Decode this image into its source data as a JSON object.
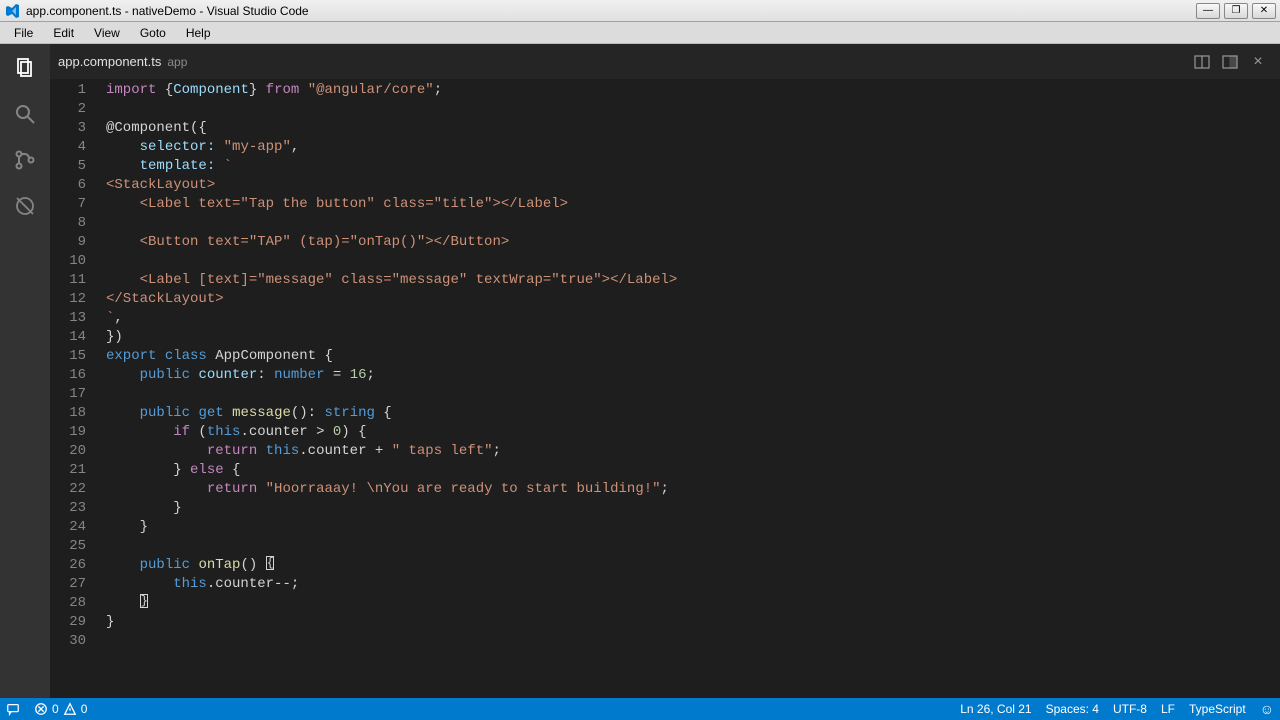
{
  "window": {
    "title": "app.component.ts - nativeDemo - Visual Studio Code"
  },
  "menubar": {
    "items": [
      "File",
      "Edit",
      "View",
      "Goto",
      "Help"
    ]
  },
  "tab": {
    "name": "app.component.ts",
    "path": "app"
  },
  "activity": {
    "items": [
      "files-icon",
      "search-icon",
      "git-icon",
      "debug-icon"
    ]
  },
  "statusbar": {
    "errors": "0",
    "warnings": "0",
    "ln_col": "Ln 26, Col 21",
    "spaces": "Spaces: 4",
    "encoding": "UTF-8",
    "eol": "LF",
    "language": "TypeScript"
  },
  "code": {
    "lines": 30,
    "content": [
      {
        "n": 1,
        "tokens": [
          {
            "t": "import",
            "c": "kw-import"
          },
          {
            "t": " ",
            "c": ""
          },
          {
            "t": "{",
            "c": ""
          },
          {
            "t": "Component",
            "c": "var"
          },
          {
            "t": "}",
            "c": ""
          },
          {
            "t": " ",
            "c": ""
          },
          {
            "t": "from",
            "c": "kw-from"
          },
          {
            "t": " ",
            "c": ""
          },
          {
            "t": "\"@angular/core\"",
            "c": "str"
          },
          {
            "t": ";",
            "c": ""
          }
        ]
      },
      {
        "n": 2,
        "tokens": []
      },
      {
        "n": 3,
        "tokens": [
          {
            "t": "@Component({",
            "c": ""
          }
        ]
      },
      {
        "n": 4,
        "tokens": [
          {
            "t": "    ",
            "c": ""
          },
          {
            "t": "selector:",
            "c": "sel"
          },
          {
            "t": " ",
            "c": ""
          },
          {
            "t": "\"my-app\"",
            "c": "str"
          },
          {
            "t": ",",
            "c": ""
          }
        ]
      },
      {
        "n": 5,
        "tokens": [
          {
            "t": "    ",
            "c": ""
          },
          {
            "t": "template:",
            "c": "sel"
          },
          {
            "t": " ",
            "c": ""
          },
          {
            "t": "`",
            "c": "str"
          }
        ]
      },
      {
        "n": 6,
        "tokens": [
          {
            "t": "<StackLayout>",
            "c": "str"
          }
        ]
      },
      {
        "n": 7,
        "tokens": [
          {
            "t": "    <Label text=\"Tap the button\" class=\"title\"></Label>",
            "c": "str"
          }
        ]
      },
      {
        "n": 8,
        "tokens": []
      },
      {
        "n": 9,
        "tokens": [
          {
            "t": "    <Button text=\"TAP\" (tap)=\"onTap()\"></Button>",
            "c": "str"
          }
        ]
      },
      {
        "n": 10,
        "tokens": []
      },
      {
        "n": 11,
        "tokens": [
          {
            "t": "    <Label [text]=\"message\" class=\"message\" textWrap=\"true\"></Label>",
            "c": "str"
          }
        ]
      },
      {
        "n": 12,
        "tokens": [
          {
            "t": "</StackLayout>",
            "c": "str"
          }
        ]
      },
      {
        "n": 13,
        "tokens": [
          {
            "t": "`",
            "c": "str"
          },
          {
            "t": ",",
            "c": ""
          }
        ]
      },
      {
        "n": 14,
        "tokens": [
          {
            "t": "})",
            "c": ""
          }
        ]
      },
      {
        "n": 15,
        "tokens": [
          {
            "t": "export",
            "c": "kw-export"
          },
          {
            "t": " ",
            "c": ""
          },
          {
            "t": "class",
            "c": "kw-class"
          },
          {
            "t": " ",
            "c": ""
          },
          {
            "t": "AppComponent",
            "c": "cls"
          },
          {
            "t": " {",
            "c": ""
          }
        ]
      },
      {
        "n": 16,
        "tokens": [
          {
            "t": "    ",
            "c": ""
          },
          {
            "t": "public",
            "c": "kw-mod"
          },
          {
            "t": " ",
            "c": ""
          },
          {
            "t": "counter",
            "c": "var"
          },
          {
            "t": ": ",
            "c": ""
          },
          {
            "t": "number",
            "c": "kw-type"
          },
          {
            "t": " = ",
            "c": ""
          },
          {
            "t": "16",
            "c": "kw-num"
          },
          {
            "t": ";",
            "c": ""
          }
        ]
      },
      {
        "n": 17,
        "tokens": []
      },
      {
        "n": 18,
        "tokens": [
          {
            "t": "    ",
            "c": ""
          },
          {
            "t": "public",
            "c": "kw-mod"
          },
          {
            "t": " ",
            "c": ""
          },
          {
            "t": "get",
            "c": "kw-get"
          },
          {
            "t": " ",
            "c": ""
          },
          {
            "t": "message",
            "c": "fn"
          },
          {
            "t": "(): ",
            "c": ""
          },
          {
            "t": "string",
            "c": "kw-type"
          },
          {
            "t": " {",
            "c": ""
          }
        ]
      },
      {
        "n": 19,
        "tokens": [
          {
            "t": "        ",
            "c": ""
          },
          {
            "t": "if",
            "c": "kw-ctrl"
          },
          {
            "t": " (",
            "c": ""
          },
          {
            "t": "this",
            "c": "kw-this"
          },
          {
            "t": ".counter > ",
            "c": ""
          },
          {
            "t": "0",
            "c": "kw-num"
          },
          {
            "t": ") {",
            "c": ""
          }
        ]
      },
      {
        "n": 20,
        "tokens": [
          {
            "t": "            ",
            "c": ""
          },
          {
            "t": "return",
            "c": "kw-return"
          },
          {
            "t": " ",
            "c": ""
          },
          {
            "t": "this",
            "c": "kw-this"
          },
          {
            "t": ".counter + ",
            "c": ""
          },
          {
            "t": "\" taps left\"",
            "c": "str"
          },
          {
            "t": ";",
            "c": ""
          }
        ]
      },
      {
        "n": 21,
        "tokens": [
          {
            "t": "        } ",
            "c": ""
          },
          {
            "t": "else",
            "c": "kw-ctrl"
          },
          {
            "t": " {",
            "c": ""
          }
        ]
      },
      {
        "n": 22,
        "tokens": [
          {
            "t": "            ",
            "c": ""
          },
          {
            "t": "return",
            "c": "kw-return"
          },
          {
            "t": " ",
            "c": ""
          },
          {
            "t": "\"Hoorraaay! \\nYou are ready to start building!\"",
            "c": "str"
          },
          {
            "t": ";",
            "c": ""
          }
        ]
      },
      {
        "n": 23,
        "tokens": [
          {
            "t": "        }",
            "c": ""
          }
        ]
      },
      {
        "n": 24,
        "tokens": [
          {
            "t": "    }",
            "c": ""
          }
        ]
      },
      {
        "n": 25,
        "tokens": []
      },
      {
        "n": 26,
        "tokens": [
          {
            "t": "    ",
            "c": ""
          },
          {
            "t": "public",
            "c": "kw-mod"
          },
          {
            "t": " ",
            "c": ""
          },
          {
            "t": "onTap",
            "c": "fn"
          },
          {
            "t": "() ",
            "c": ""
          }
        ],
        "cursor_after": true,
        "cursor_char": "{"
      },
      {
        "n": 27,
        "tokens": [
          {
            "t": "        ",
            "c": ""
          },
          {
            "t": "this",
            "c": "kw-this"
          },
          {
            "t": ".counter--;",
            "c": ""
          }
        ]
      },
      {
        "n": 28,
        "tokens": [
          {
            "t": "    ",
            "c": ""
          }
        ],
        "cursor_after": true,
        "cursor_char": "}"
      },
      {
        "n": 29,
        "tokens": [
          {
            "t": "}",
            "c": ""
          }
        ]
      },
      {
        "n": 30,
        "tokens": []
      }
    ]
  }
}
